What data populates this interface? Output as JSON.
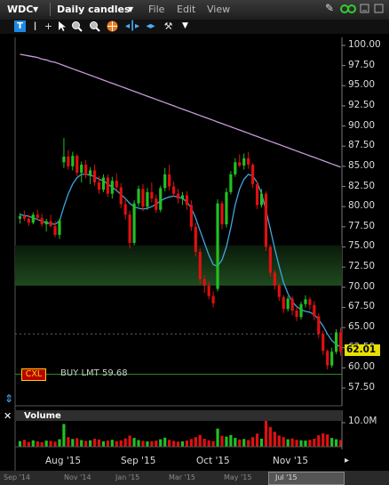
{
  "header": {
    "symbol": "WDC",
    "chart_type": "Daily candles",
    "menus": [
      "File",
      "Edit",
      "View"
    ]
  },
  "toolbar": {
    "icons": [
      "T-icon",
      "cursor-icon",
      "zoom-in-icon",
      "zoom-out-icon",
      "crosshair-icon",
      "split-icon",
      "arrows-icon",
      "wrench-icon",
      "dropdown-icon"
    ]
  },
  "chart_data": {
    "type": "candlestick",
    "symbol": "WDC",
    "y_ticks": [
      "100.00",
      "97.50",
      "95.00",
      "92.50",
      "90.00",
      "87.50",
      "85.00",
      "82.50",
      "80.00",
      "77.50",
      "75.00",
      "72.50",
      "70.00",
      "67.50",
      "65.00",
      "62.50",
      "60.00",
      "57.50"
    ],
    "ylim": [
      56,
      101
    ],
    "x_ticks": [
      "Aug '15",
      "Sep '15",
      "Oct '15",
      "Nov '15"
    ],
    "last_price": "62.01",
    "ohlc": [
      [
        78.5,
        79.2,
        77.9,
        78.8
      ],
      [
        78.8,
        79.5,
        78.2,
        78.5
      ],
      [
        78.5,
        79.0,
        77.6,
        78.0
      ],
      [
        78.0,
        79.3,
        77.8,
        79.0
      ],
      [
        79.0,
        79.6,
        78.3,
        78.6
      ],
      [
        78.6,
        79.1,
        77.5,
        77.8
      ],
      [
        77.8,
        78.5,
        76.9,
        78.2
      ],
      [
        78.2,
        79.0,
        77.4,
        77.6
      ],
      [
        77.6,
        78.2,
        76.2,
        76.5
      ],
      [
        76.5,
        78.5,
        76.0,
        78.3
      ],
      [
        85.5,
        88.5,
        84.8,
        86.2
      ],
      [
        86.2,
        87.0,
        84.6,
        85.0
      ],
      [
        85.0,
        86.8,
        84.5,
        86.3
      ],
      [
        86.3,
        86.5,
        83.8,
        84.2
      ],
      [
        84.2,
        85.6,
        83.0,
        85.2
      ],
      [
        85.2,
        85.8,
        83.5,
        83.9
      ],
      [
        83.9,
        84.9,
        82.8,
        84.5
      ],
      [
        84.5,
        85.2,
        82.6,
        83.0
      ],
      [
        83.0,
        83.8,
        81.6,
        82.1
      ],
      [
        82.1,
        84.0,
        81.8,
        83.6
      ],
      [
        83.6,
        84.0,
        81.2,
        81.6
      ],
      [
        81.6,
        83.7,
        81.0,
        83.2
      ],
      [
        83.2,
        84.1,
        82.0,
        82.4
      ],
      [
        82.4,
        82.9,
        79.8,
        80.3
      ],
      [
        80.3,
        81.0,
        78.4,
        79.0
      ],
      [
        79.0,
        79.5,
        74.8,
        75.5
      ],
      [
        75.5,
        80.8,
        75.2,
        80.4
      ],
      [
        80.4,
        82.6,
        80.0,
        82.2
      ],
      [
        82.2,
        82.8,
        79.4,
        80.0
      ],
      [
        80.0,
        82.3,
        79.6,
        81.8
      ],
      [
        81.8,
        83.0,
        80.5,
        81.0
      ],
      [
        81.0,
        81.5,
        79.2,
        79.6
      ],
      [
        79.6,
        82.6,
        79.3,
        82.3
      ],
      [
        82.3,
        84.8,
        81.9,
        84.0
      ],
      [
        84.0,
        85.2,
        82.0,
        82.5
      ],
      [
        82.5,
        83.1,
        81.2,
        81.6
      ],
      [
        81.6,
        82.2,
        80.4,
        81.0
      ],
      [
        81.0,
        81.8,
        80.2,
        81.4
      ],
      [
        81.4,
        81.9,
        79.6,
        80.2
      ],
      [
        80.2,
        80.8,
        77.0,
        77.5
      ],
      [
        77.5,
        78.0,
        73.8,
        74.4
      ],
      [
        74.4,
        74.8,
        70.4,
        71.0
      ],
      [
        71.0,
        71.5,
        69.3,
        70.2
      ],
      [
        70.2,
        70.7,
        68.5,
        68.9
      ],
      [
        68.9,
        69.5,
        67.5,
        68.0
      ],
      [
        69.8,
        80.9,
        69.5,
        80.4
      ],
      [
        80.4,
        80.7,
        77.2,
        77.8
      ],
      [
        77.8,
        82.3,
        77.4,
        81.8
      ],
      [
        81.8,
        84.4,
        81.5,
        84.0
      ],
      [
        84.0,
        86.0,
        83.7,
        85.5
      ],
      [
        85.5,
        86.5,
        84.9,
        85.1
      ],
      [
        85.1,
        86.6,
        84.6,
        86.0
      ],
      [
        86.0,
        86.8,
        84.7,
        85.2
      ],
      [
        85.2,
        85.4,
        82.3,
        82.8
      ],
      [
        82.8,
        83.1,
        79.7,
        80.2
      ],
      [
        80.2,
        82.2,
        79.9,
        81.6
      ],
      [
        81.6,
        81.9,
        74.5,
        75.0
      ],
      [
        75.0,
        75.3,
        71.3,
        71.8
      ],
      [
        71.8,
        72.1,
        69.7,
        70.2
      ],
      [
        70.2,
        70.5,
        68.3,
        68.8
      ],
      [
        68.8,
        69.0,
        66.8,
        67.3
      ],
      [
        67.3,
        68.9,
        67.0,
        68.6
      ],
      [
        68.6,
        68.9,
        66.5,
        67.1
      ],
      [
        67.1,
        67.6,
        65.8,
        66.3
      ],
      [
        66.3,
        68.2,
        66.0,
        67.9
      ],
      [
        67.9,
        69.0,
        67.5,
        68.5
      ],
      [
        68.5,
        68.8,
        67.2,
        67.8
      ],
      [
        67.8,
        68.3,
        65.9,
        66.4
      ],
      [
        66.4,
        66.8,
        63.7,
        64.2
      ],
      [
        64.2,
        64.6,
        61.6,
        62.1
      ],
      [
        62.1,
        62.3,
        59.8,
        60.3
      ],
      [
        60.3,
        62.5,
        60.0,
        62.0
      ],
      [
        62.0,
        64.8,
        61.7,
        64.4
      ],
      [
        64.4,
        65.0,
        61.5,
        62.0
      ]
    ],
    "series": [
      {
        "name": "MA short",
        "color": "#3ea6e0",
        "values": [
          79.0,
          78.9,
          78.8,
          78.6,
          78.4,
          78.2,
          78.0,
          77.9,
          77.8,
          78.2,
          80.0,
          81.6,
          82.8,
          83.6,
          84.0,
          84.0,
          83.9,
          83.7,
          83.4,
          83.2,
          82.8,
          82.4,
          82.0,
          81.5,
          81.0,
          80.4,
          80.0,
          79.8,
          79.7,
          79.8,
          80.0,
          80.3,
          80.7,
          81.0,
          81.2,
          81.3,
          81.2,
          81.0,
          80.6,
          79.8,
          78.6,
          77.0,
          75.5,
          74.0,
          72.8,
          72.6,
          73.4,
          75.0,
          77.4,
          80.2,
          82.2,
          83.4,
          84.0,
          83.8,
          83.0,
          81.6,
          79.6,
          77.2,
          74.8,
          72.6,
          70.6,
          69.2,
          68.2,
          67.6,
          67.2,
          67.0,
          66.9,
          66.6,
          66.0,
          65.2,
          64.2,
          63.4,
          62.9,
          62.6
        ]
      },
      {
        "name": "MA long",
        "color": "#c89ad8",
        "values": [
          98.9,
          98.8,
          98.7,
          98.6,
          98.5,
          98.3,
          98.2,
          98.0,
          97.9,
          97.7,
          97.5,
          97.3,
          97.1,
          96.9,
          96.7,
          96.5,
          96.3,
          96.1,
          95.9,
          95.7,
          95.5,
          95.3,
          95.1,
          94.9,
          94.7,
          94.5,
          94.3,
          94.1,
          93.9,
          93.7,
          93.5,
          93.3,
          93.1,
          92.9,
          92.7,
          92.5,
          92.3,
          92.1,
          91.9,
          91.7,
          91.5,
          91.3,
          91.1,
          90.9,
          90.7,
          90.5,
          90.3,
          90.1,
          89.9,
          89.7,
          89.5,
          89.3,
          89.1,
          88.9,
          88.7,
          88.5,
          88.3,
          88.1,
          87.9,
          87.7,
          87.5,
          87.3,
          87.1,
          86.9,
          86.7,
          86.5,
          86.3,
          86.1,
          85.9,
          85.7,
          85.5,
          85.3,
          85.1,
          84.9
        ]
      }
    ],
    "volume": {
      "label": "Volume",
      "tick": "10.0M",
      "max": 12,
      "values": [
        2.1,
        2.6,
        1.8,
        2.4,
        2.0,
        1.7,
        2.3,
        2.2,
        1.9,
        2.8,
        8.5,
        3.6,
        2.9,
        3.2,
        2.5,
        2.2,
        2.4,
        3.0,
        2.7,
        2.0,
        2.3,
        2.6,
        2.1,
        2.4,
        3.1,
        4.2,
        3.3,
        2.5,
        2.2,
        2.0,
        2.1,
        2.3,
        2.8,
        3.4,
        2.6,
        2.2,
        1.9,
        2.0,
        2.3,
        2.9,
        3.6,
        4.4,
        3.0,
        2.4,
        2.1,
        6.8,
        4.1,
        3.8,
        4.4,
        3.3,
        2.7,
        2.9,
        2.5,
        3.6,
        4.9,
        3.0,
        12.5,
        7.4,
        5.6,
        4.2,
        3.6,
        2.8,
        3.1,
        2.6,
        2.4,
        2.3,
        2.6,
        3.0,
        4.3,
        5.0,
        4.6,
        3.3,
        2.8,
        2.5
      ]
    }
  },
  "order": {
    "cancel_label": "CXL",
    "description": "BUY LMT 59.68",
    "price": 59.68
  },
  "navigator": {
    "labels": [
      "Sep '14",
      "Nov '14",
      "Jan '15",
      "Mar '15",
      "May '15",
      "Jul '15"
    ]
  }
}
